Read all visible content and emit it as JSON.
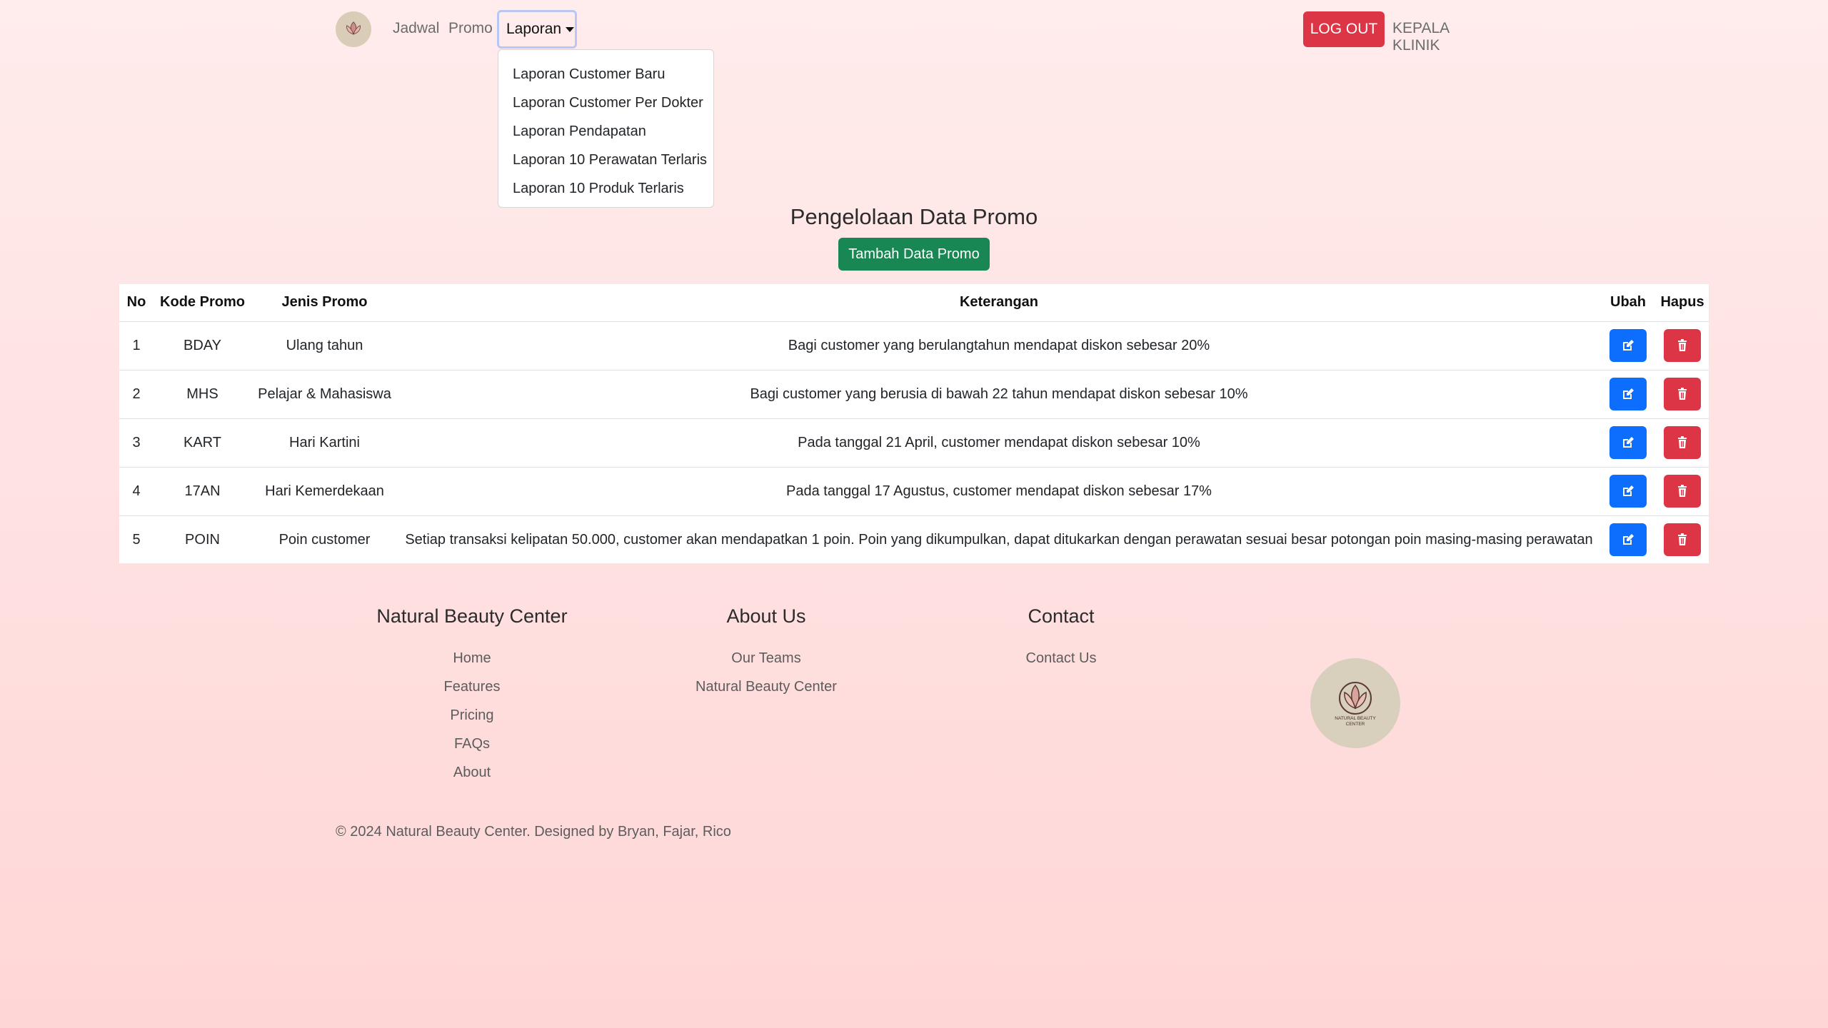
{
  "nav": {
    "jadwal": "Jadwal",
    "promo": "Promo",
    "laporan": "Laporan",
    "logout": "LOG OUT",
    "role": "KEPALA KLINIK"
  },
  "dropdown": {
    "items": [
      "Laporan Customer Baru",
      "Laporan Customer Per Dokter",
      "Laporan Pendapatan",
      "Laporan 10 Perawatan Terlaris",
      "Laporan 10 Produk Terlaris"
    ]
  },
  "main": {
    "title": "Pengelolaan Data Promo",
    "add_button": "Tambah Data Promo"
  },
  "table": {
    "headers": [
      "No",
      "Kode Promo",
      "Jenis Promo",
      "Keterangan",
      "Ubah",
      "Hapus"
    ],
    "rows": [
      {
        "no": "1",
        "kode": "BDAY",
        "jenis": "Ulang tahun",
        "keterangan": "Bagi customer yang berulangtahun mendapat diskon sebesar 20%"
      },
      {
        "no": "2",
        "kode": "MHS",
        "jenis": "Pelajar & Mahasiswa",
        "keterangan": "Bagi customer yang berusia di bawah 22 tahun mendapat diskon sebesar 10%"
      },
      {
        "no": "3",
        "kode": "KART",
        "jenis": "Hari Kartini",
        "keterangan": "Pada tanggal 21 April, customer mendapat diskon sebesar 10%"
      },
      {
        "no": "4",
        "kode": "17AN",
        "jenis": "Hari Kemerdekaan",
        "keterangan": "Pada tanggal 17 Agustus, customer mendapat diskon sebesar 17%"
      },
      {
        "no": "5",
        "kode": "POIN",
        "jenis": "Poin customer",
        "keterangan": "Setiap transaksi kelipatan 50.000, customer akan mendapatkan 1 poin. Poin yang dikumpulkan, dapat ditukarkan dengan perawatan sesuai besar potongan poin masing-masing perawatan"
      }
    ]
  },
  "footer": {
    "col1": {
      "title": "Natural Beauty Center",
      "links": [
        "Home",
        "Features",
        "Pricing",
        "FAQs",
        "About"
      ]
    },
    "col2": {
      "title": "About Us",
      "links": [
        "Our Teams",
        "Natural Beauty Center"
      ]
    },
    "col3": {
      "title": "Contact",
      "links": [
        "Contact Us"
      ]
    },
    "logo_text": "NATURAL BEAUTY CENTER",
    "copyright": "© 2024 Natural Beauty Center. Designed by Bryan, Fajar, Rico"
  },
  "colors": {
    "primary": "#0d6efd",
    "danger": "#dc3545",
    "success": "#198754"
  }
}
